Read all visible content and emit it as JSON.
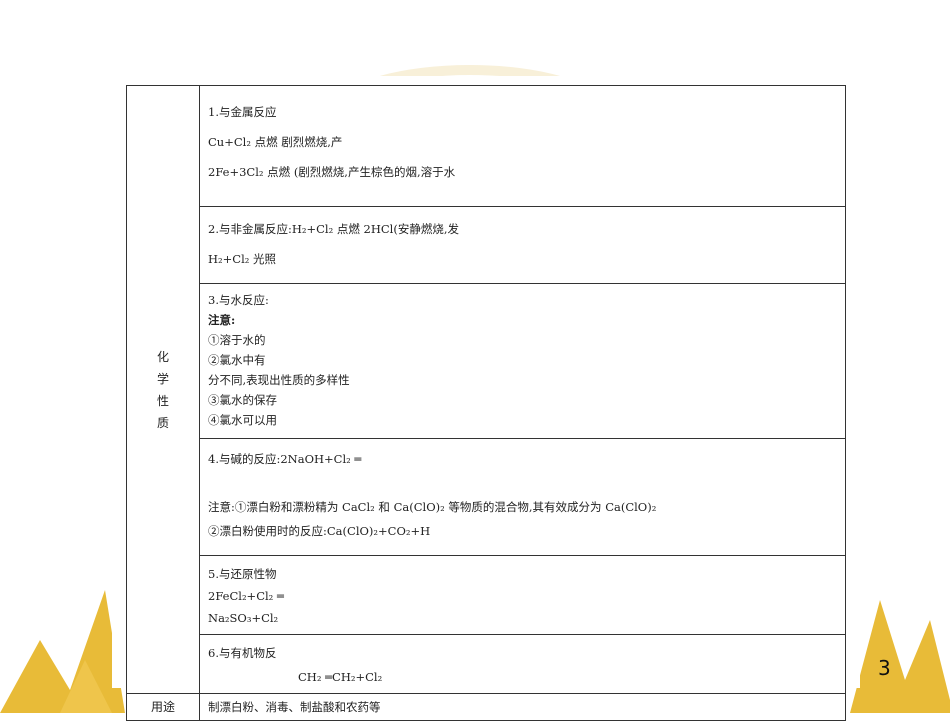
{
  "page_number": "3",
  "colors": {
    "border": "#333333",
    "decoration": "#e6b422"
  },
  "table": {
    "property_label": [
      "化",
      "学",
      "性",
      "质"
    ],
    "sections": [
      {
        "lines": [
          "1.与金属反应",
          "Cu+Cl₂ 点燃 剧烈燃烧,产",
          "2Fe+3Cl₂ 点燃 (剧烈燃烧,产生棕色的烟,溶于水"
        ]
      },
      {
        "lines": [
          "2.与非金属反应:H₂+Cl₂ 点燃 2HCl(安静燃烧,发",
          "H₂+Cl₂ 光照"
        ]
      },
      {
        "lines": [
          "3.与水反应:",
          "注意:",
          "①溶于水的",
          "②氯水中有",
          "分不同,表现出性质的多样性",
          "③氯水的保存",
          "④氯水可以用"
        ]
      },
      {
        "lines": [
          "4.与碱的反应:2NaOH+Cl₂ ═",
          "",
          "注意:①漂白粉和漂粉精为 CaCl₂ 和 Ca(ClO)₂ 等物质的混合物,其有效成分为 Ca(ClO)₂",
          "②漂白粉使用时的反应:Ca(ClO)₂+CO₂+H"
        ]
      },
      {
        "lines": [
          "5.与还原性物",
          "2FeCl₂+Cl₂ ═",
          "Na₂SO₃+Cl₂"
        ]
      },
      {
        "lines": [
          "6.与有机物反",
          "CH₂ ═CH₂+Cl₂"
        ]
      }
    ],
    "usage_label": "用途",
    "usage_value": "制漂白粉、消毒、制盐酸和农药等"
  }
}
